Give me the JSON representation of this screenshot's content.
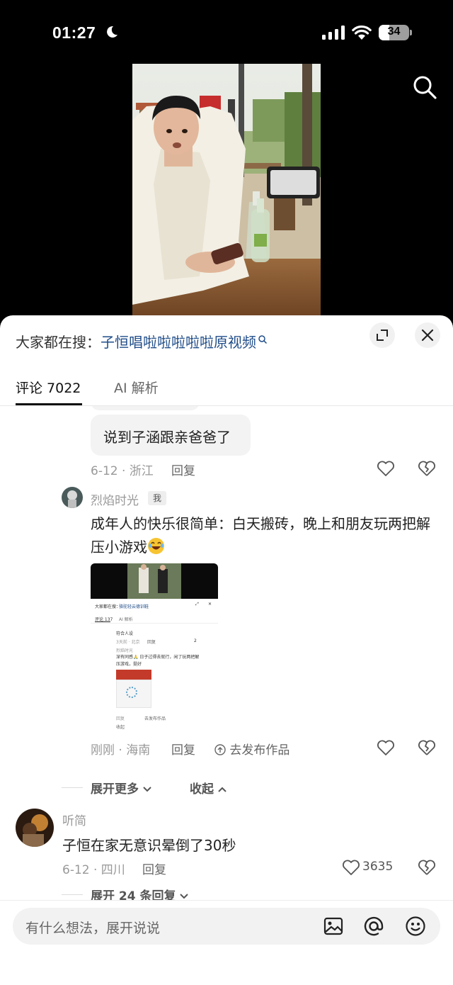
{
  "status_bar": {
    "time": "01:27",
    "battery": "34"
  },
  "hot_search": {
    "prefix": "大家都在搜：",
    "keyword": "子恒唱啦啦啦啦啦原视频"
  },
  "tabs": [
    {
      "label": "评论 7022",
      "active": true
    },
    {
      "label": "AI 解析",
      "active": false
    }
  ],
  "comments": {
    "reply1": {
      "text": "说到子涵跟亲爸爸了",
      "meta": "6-12 · 浙江",
      "reply_label": "回复"
    },
    "reply2": {
      "username": "烈焰时光",
      "me_tag": "我",
      "text": "成年人的快乐很简单：白天搬砖，晚上和朋友玩两把解压小游戏",
      "meta": "刚刚 · 海南",
      "reply_label": "回复",
      "publish_label": "去发布作品",
      "thumbnail": {
        "hot_search": "大家都在搜：",
        "hot_keyword": "骆驼轻云德训鞋",
        "tab1": "评论 137",
        "tab2": "AI 解析",
        "comment1": "符合人设",
        "meta1": "3天前 · 北京",
        "reply": "回复",
        "count1": "2",
        "user2": "烈焰时光",
        "text2": "深有同感🙏 日子过得去就行，闲了玩两把解压游戏，挺好",
        "footer": "回复",
        "publish": "去发布作品",
        "collapse": "收起"
      }
    },
    "expand_more": "展开更多",
    "collapse": "收起",
    "top2": {
      "username": "听简",
      "text": "子恒在家无意识晕倒了30秒",
      "meta": "6-12 · 四川",
      "reply_label": "回复",
      "likes": "3635",
      "expand_replies": "展开 24 条回复"
    }
  },
  "input": {
    "placeholder": "有什么想法，展开说说"
  },
  "icons": [
    "moon-icon",
    "signal-icon",
    "wifi-icon",
    "search-icon",
    "expand-icon",
    "close-icon",
    "heart-icon",
    "broken-heart-icon",
    "image-icon",
    "at-icon",
    "emoji-icon"
  ]
}
